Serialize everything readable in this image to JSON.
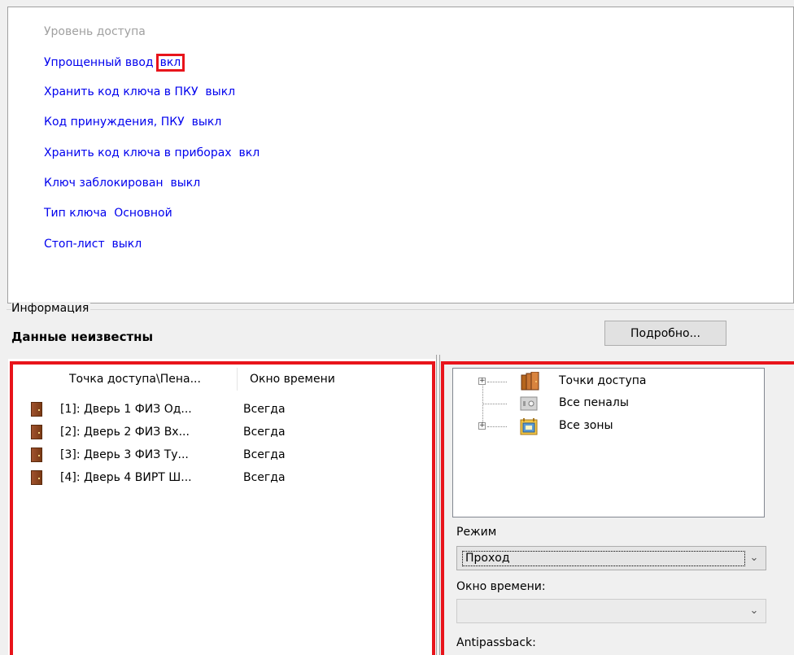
{
  "properties": {
    "access_level": "Уровень доступа",
    "simplified_entry_label": "Упрощенный ввод",
    "simplified_entry_value": "вкл",
    "store_key_pku": "Хранить код ключа в ПКУ  выкл",
    "duress_code": "Код принуждения, ПКУ  выкл",
    "store_key_devices": "Хранить код ключа в приборах  вкл",
    "key_blocked": "Ключ заблокирован  выкл",
    "key_type": "Тип ключа  Основной",
    "stop_list": "Стоп-лист  выкл"
  },
  "info": {
    "label": "Информация",
    "value": "Данные неизвестны",
    "details_button": "Подробно..."
  },
  "access_grid": {
    "columns": [
      "Точка доступа\\Пена...",
      "Окно времени"
    ],
    "rows": [
      {
        "name": "[1]: Дверь 1 ФИЗ Од...",
        "time": "Всегда"
      },
      {
        "name": "[2]: Дверь 2 ФИЗ Вх...",
        "time": "Всегда"
      },
      {
        "name": "[3]: Дверь 3 ФИЗ Ту...",
        "time": "Всегда"
      },
      {
        "name": "[4]: Дверь 4 ВИРТ Ш...",
        "time": "Всегда"
      }
    ]
  },
  "tree": {
    "items": [
      {
        "label": "Точки доступа",
        "icon": "doors-icon"
      },
      {
        "label": "Все пеналы",
        "icon": "safe-icon"
      },
      {
        "label": "Все зоны",
        "icon": "zones-icon"
      }
    ]
  },
  "mode": {
    "label": "Режим",
    "value": "Проход"
  },
  "time_window": {
    "label": "Окно времени:",
    "value": ""
  },
  "antipassback": {
    "label": "Antipassback:"
  },
  "colors": {
    "highlight": "#e8141b",
    "link": "#0000ee",
    "disabled": "#a0a0a0"
  }
}
